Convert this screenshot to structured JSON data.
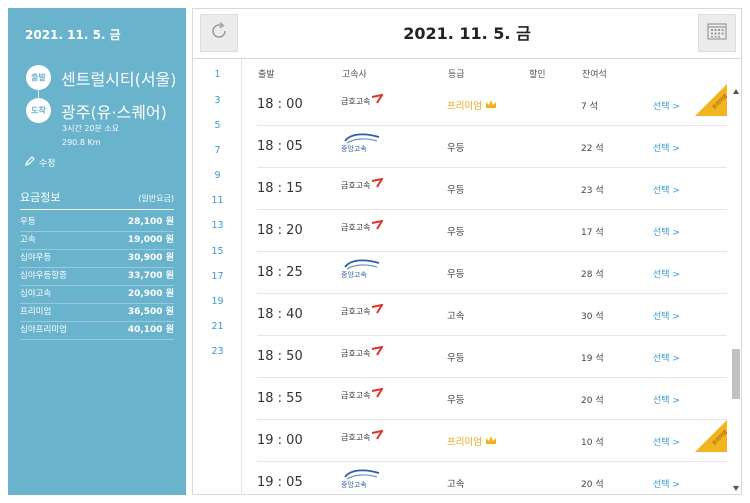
{
  "left_panel": {
    "date": "2021. 11. 5. 금",
    "departure": {
      "badge": "출발",
      "city": "센트럴시티(서울)"
    },
    "arrival": {
      "badge": "도착",
      "city": "광주(유·스퀘어)"
    },
    "duration": "3시간 20분 소요",
    "distance": "290.8 Km",
    "edit_label": "수정",
    "fare_title": "요금정보",
    "fare_subtitle": "(일반요금)",
    "fares": [
      {
        "name": "우등",
        "price": "28,100 원"
      },
      {
        "name": "고속",
        "price": "19,000 원"
      },
      {
        "name": "심야우등",
        "price": "30,900 원"
      },
      {
        "name": "심야우등할증",
        "price": "33,700 원"
      },
      {
        "name": "심야고속",
        "price": "20,900 원"
      },
      {
        "name": "프리미엄",
        "price": "36,500 원"
      },
      {
        "name": "심야프리미엄",
        "price": "40,100 원"
      }
    ]
  },
  "header": {
    "date_title": "2021. 11. 5. 금"
  },
  "hours": [
    "1",
    "3",
    "5",
    "7",
    "9",
    "11",
    "13",
    "15",
    "17",
    "19",
    "21",
    "23"
  ],
  "columns": {
    "departure": "출발",
    "company": "고속사",
    "grade": "등급",
    "discount": "할인",
    "seats": "잔여석"
  },
  "schedule": [
    {
      "time": "18 : 00",
      "company": "금호고속",
      "logo": "kumho",
      "grade": "프리미엄",
      "premium": true,
      "seats": "7 석",
      "select": "선택 >",
      "ribbon": "프리미엄"
    },
    {
      "time": "18 : 05",
      "company": "중앙고속",
      "logo": "jungang",
      "grade": "우등",
      "premium": false,
      "seats": "22 석",
      "select": "선택 >"
    },
    {
      "time": "18 : 15",
      "company": "금호고속",
      "logo": "kumho",
      "grade": "우등",
      "premium": false,
      "seats": "23 석",
      "select": "선택 >"
    },
    {
      "time": "18 : 20",
      "company": "금호고속",
      "logo": "kumho",
      "grade": "우등",
      "premium": false,
      "seats": "17 석",
      "select": "선택 >"
    },
    {
      "time": "18 : 25",
      "company": "중앙고속",
      "logo": "jungang",
      "grade": "우등",
      "premium": false,
      "seats": "28 석",
      "select": "선택 >"
    },
    {
      "time": "18 : 40",
      "company": "금호고속",
      "logo": "kumho",
      "grade": "고속",
      "premium": false,
      "seats": "30 석",
      "select": "선택 >"
    },
    {
      "time": "18 : 50",
      "company": "금호고속",
      "logo": "kumho",
      "grade": "우등",
      "premium": false,
      "seats": "19 석",
      "select": "선택 >"
    },
    {
      "time": "18 : 55",
      "company": "금호고속",
      "logo": "kumho",
      "grade": "우등",
      "premium": false,
      "seats": "20 석",
      "select": "선택 >"
    },
    {
      "time": "19 : 00",
      "company": "금호고속",
      "logo": "kumho",
      "grade": "프리미엄",
      "premium": true,
      "seats": "10 석",
      "select": "선택 >",
      "ribbon": "프리미엄"
    },
    {
      "time": "19 : 05",
      "company": "중앙고속",
      "logo": "jungang",
      "grade": "고속",
      "premium": false,
      "seats": "20 석",
      "select": "선택 >"
    }
  ],
  "colors": {
    "panel": "#6ab3cd",
    "accent_link": "#3a9ad6",
    "premium": "#f0a21c"
  }
}
